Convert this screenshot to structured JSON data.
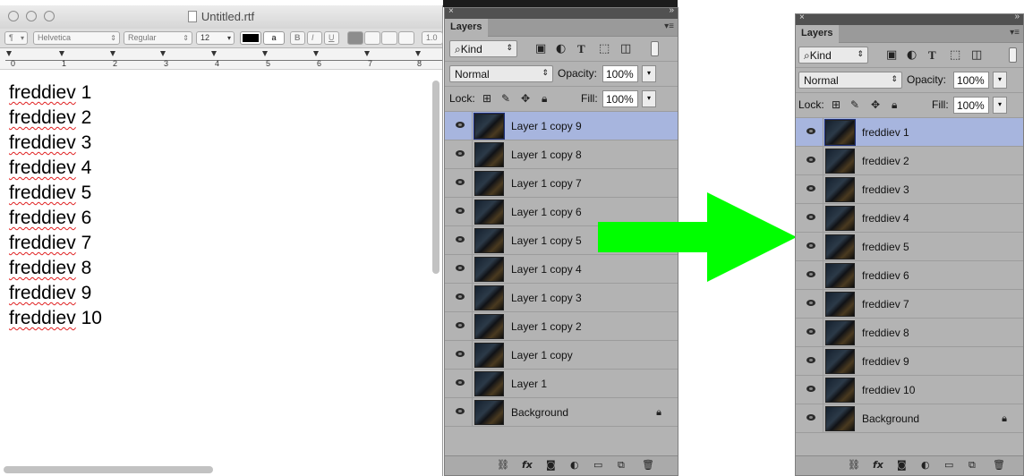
{
  "textedit": {
    "title": "Untitled.rtf",
    "toolbar": {
      "paragraph": "¶",
      "font": "Helvetica",
      "style": "Regular",
      "size": "12",
      "bold": "B",
      "italic": "I",
      "underline": "U",
      "spacing": "1.0"
    },
    "ruler_numbers": [
      "0",
      "1",
      "2",
      "3",
      "4",
      "5",
      "6",
      "7",
      "8"
    ],
    "lines": [
      {
        "word": "freddiev",
        "num": "1"
      },
      {
        "word": "freddiev",
        "num": "2"
      },
      {
        "word": "freddiev",
        "num": "3"
      },
      {
        "word": "freddiev",
        "num": "4"
      },
      {
        "word": "freddiev",
        "num": "5"
      },
      {
        "word": "freddiev",
        "num": "6"
      },
      {
        "word": "freddiev",
        "num": "7"
      },
      {
        "word": "freddiev",
        "num": "8"
      },
      {
        "word": "freddiev",
        "num": "9"
      },
      {
        "word": "freddiev",
        "num": "10"
      }
    ]
  },
  "left_panel": {
    "tab": "Layers",
    "filter": "Kind",
    "blend_mode": "Normal",
    "opacity_label": "Opacity:",
    "opacity": "100%",
    "lock_label": "Lock:",
    "fill_label": "Fill:",
    "fill": "100%",
    "layers": [
      "Layer 1 copy 9",
      "Layer 1 copy 8",
      "Layer 1 copy 7",
      "Layer 1 copy 6",
      "Layer 1 copy 5",
      "Layer 1 copy 4",
      "Layer 1 copy 3",
      "Layer 1 copy 2",
      "Layer 1 copy",
      "Layer 1",
      "Background"
    ]
  },
  "right_panel": {
    "tab": "Layers",
    "filter": "Kind",
    "blend_mode": "Normal",
    "opacity_label": "Opacity:",
    "opacity": "100%",
    "lock_label": "Lock:",
    "fill_label": "Fill:",
    "fill": "100%",
    "layers": [
      "freddiev 1",
      "freddiev 2",
      "freddiev 3",
      "freddiev 4",
      "freddiev 5",
      "freddiev 6",
      "freddiev 7",
      "freddiev 8",
      "freddiev 9",
      "freddiev 10",
      "Background"
    ]
  },
  "colors": {
    "selected_layer": "#a7b5de",
    "arrow": "#00ff00",
    "panel_bg": "#b3b3b3"
  },
  "icons": {
    "eye": "eye-icon",
    "lock": "lock-icon",
    "link": "link-icon",
    "fx": "fx-icon",
    "mask": "mask-icon",
    "adjustment": "adjustment-icon",
    "folder": "folder-icon",
    "new_layer": "new-layer-icon",
    "trash": "trash-icon"
  }
}
